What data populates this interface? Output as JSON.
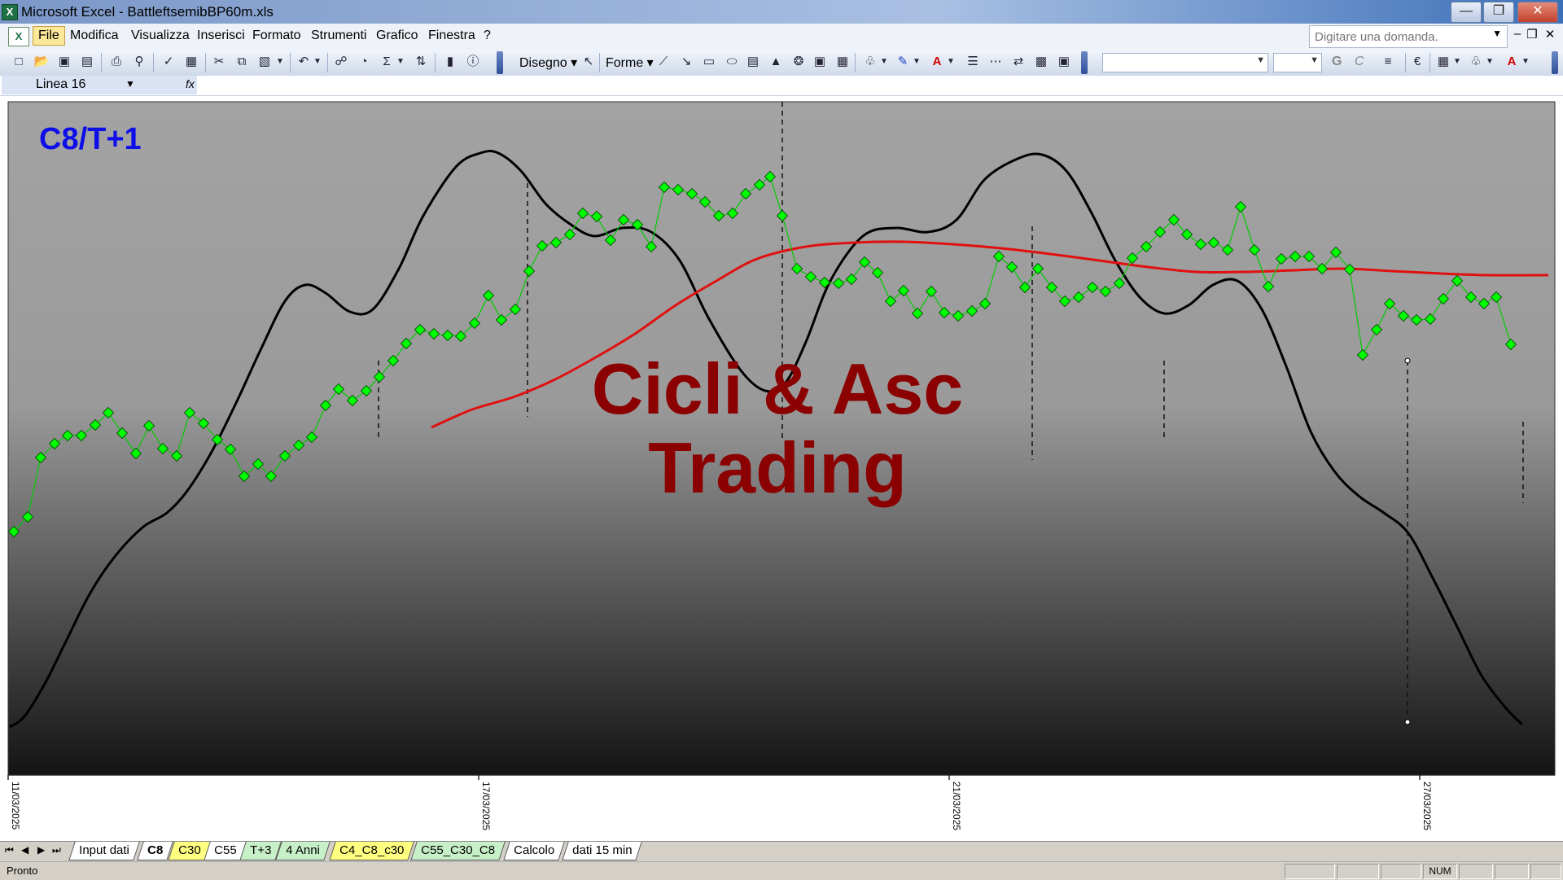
{
  "window": {
    "title": "Microsoft Excel - BattleftsemibBP60m.xls",
    "app_icon": "excel-icon"
  },
  "menu": {
    "items": [
      "File",
      "Modifica",
      "Visualizza",
      "Inserisci",
      "Formato",
      "Strumenti",
      "Grafico",
      "Finestra",
      "?"
    ],
    "help_placeholder": "Digitare una domanda."
  },
  "toolbar": {
    "disegno_label": "Disegno",
    "forme_label": "Forme",
    "bold_label": "G",
    "italic_label": "C"
  },
  "namebox": {
    "value": "Linea 16",
    "fx_label": "fx"
  },
  "chart": {
    "label": "C8/T+1",
    "watermark_line1": "Cicli & Asc",
    "watermark_line2": "Trading",
    "x_ticks": [
      "11/03/2025",
      "17/03/2025",
      "21/03/2025",
      "27/03/2025"
    ],
    "colors": {
      "price_series": "#00ee00",
      "cycle_line": "#000000",
      "average_line": "#e01010",
      "label": "#0e0ee8",
      "watermark": "#8b0000"
    }
  },
  "sheets": {
    "tabs": [
      {
        "label": "Input dati",
        "color": "#ffffff"
      },
      {
        "label": "C8",
        "color": "#ffffff",
        "active": true
      },
      {
        "label": "C30",
        "color": "#ffff80"
      },
      {
        "label": "C55",
        "color": "#ffffff"
      },
      {
        "label": "T+3",
        "color": "#c8f0c8"
      },
      {
        "label": "4 Anni",
        "color": "#c8f0c8"
      },
      {
        "label": "C4_C8_c30",
        "color": "#ffff80"
      },
      {
        "label": "C55_C30_C8",
        "color": "#c8f0c8"
      },
      {
        "label": "Calcolo",
        "color": "#ffffff"
      },
      {
        "label": "dati 15 min",
        "color": "#ffffff"
      }
    ]
  },
  "status": {
    "text": "Pronto",
    "num": "NUM"
  }
}
